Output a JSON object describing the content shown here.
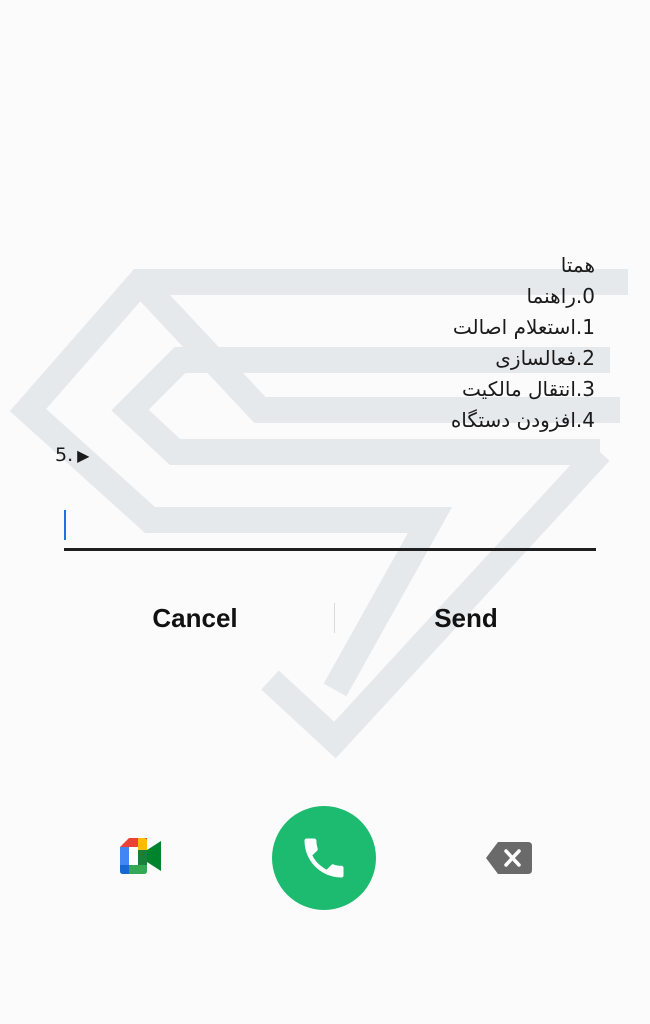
{
  "ussd": {
    "lines": [
      "همتا",
      "0.راهنما",
      "1.استعلام اصالت",
      "2.فعالسازی",
      "3.انتقال مالکیت",
      "4.افزودن دستگاه"
    ],
    "prompt": "5.",
    "prompt_icon": "play-arrow-icon"
  },
  "reply": {
    "value": "",
    "placeholder": ""
  },
  "buttons": {
    "cancel": "Cancel",
    "send": "Send"
  },
  "dialer": {
    "video_icon": "google-meet-icon",
    "call_icon": "phone-icon",
    "delete_icon": "backspace-icon",
    "call_color": "#1dbb6f"
  },
  "colors": {
    "accent": "#1a73e8",
    "watermark": "#e8ebee"
  }
}
